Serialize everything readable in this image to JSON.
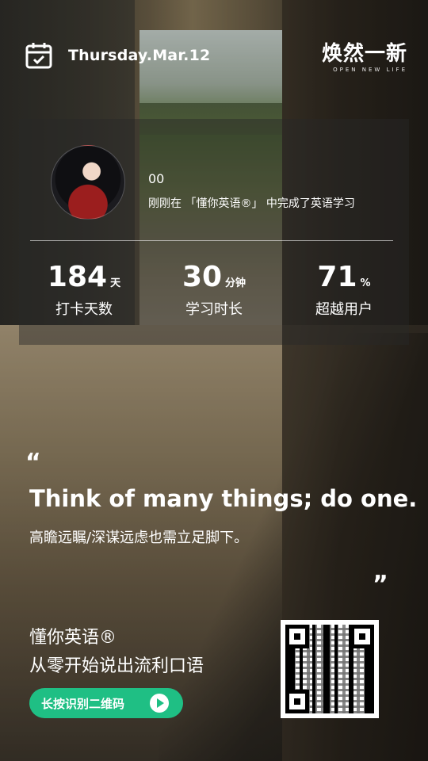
{
  "header": {
    "date": "Thursday.Mar.12",
    "brand_main": "焕然一新",
    "brand_sub": "OPEN NEW LIFE"
  },
  "card": {
    "username": "00",
    "activity": "刚刚在 「懂你英语®」 中完成了英语学习",
    "stats": [
      {
        "value": "184",
        "unit": "天",
        "label": "打卡天数"
      },
      {
        "value": "30",
        "unit": "分钟",
        "label": "学习时长"
      },
      {
        "value": "71",
        "unit": "%",
        "label": "超越用户"
      }
    ]
  },
  "quote": {
    "open_mark": "“",
    "english": "Think of many things; do one.",
    "chinese": "高瞻远瞩/深谋远虑也需立足脚下。",
    "close_mark": "”"
  },
  "footer": {
    "app_name": "懂你英语®",
    "tagline": "从零开始说出流利口语",
    "cta_label": "长按识别二维码"
  },
  "colors": {
    "accent": "#1fbf84"
  }
}
